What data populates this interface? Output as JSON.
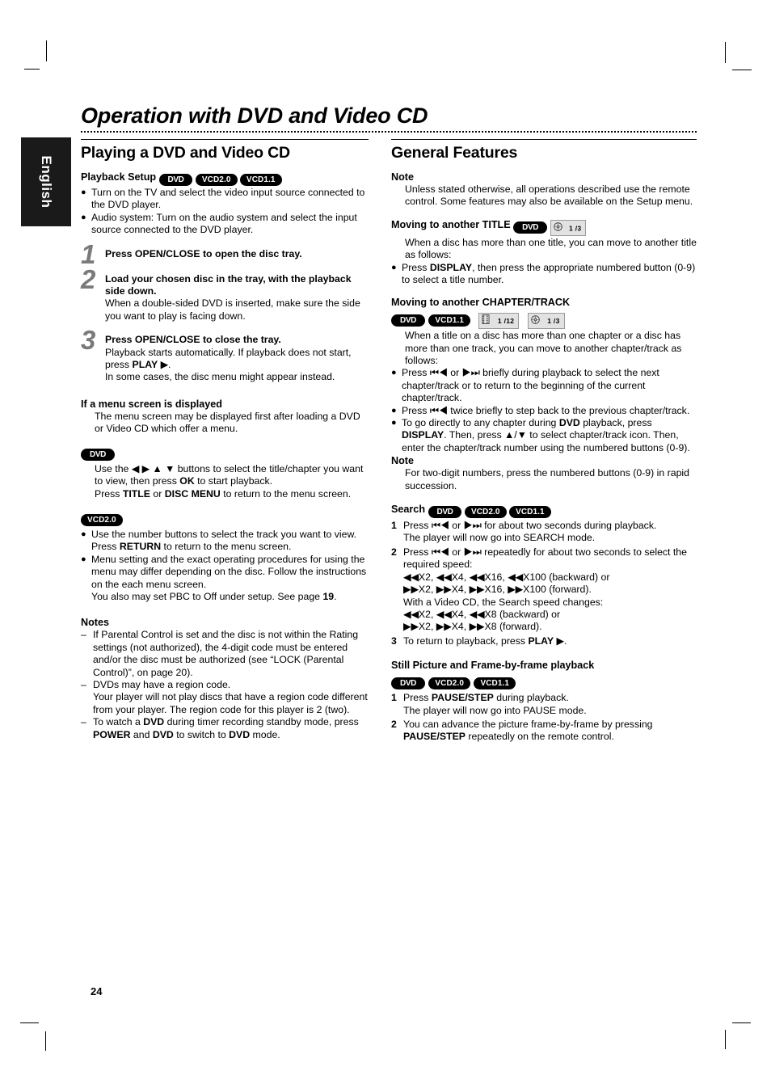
{
  "document": {
    "title": "Operation with DVD and Video CD",
    "language_tab": "English",
    "page_number": "24"
  },
  "pills": {
    "dvd": "DVD",
    "vcd20": "VCD2.0",
    "vcd11": "VCD1.1"
  },
  "badges": {
    "disc_title": "1 /3",
    "chapter": "1 /12",
    "track": "1 /3"
  },
  "left_column": {
    "section_title": "Playing a DVD and Video CD",
    "playback_setup": {
      "heading": "Playback Setup",
      "bullets": [
        "Turn on the TV and select the video input source connected to the DVD player.",
        "Audio system: Turn on the audio system and select the input source connected to the DVD player."
      ]
    },
    "steps": [
      {
        "number": "1",
        "bold": "Press OPEN/CLOSE to open the disc tray.",
        "lines": []
      },
      {
        "number": "2",
        "bold": "Load your chosen disc in the tray, with the playback side down.",
        "lines": [
          "When a double-sided DVD is inserted, make sure the side you want to play is facing down."
        ]
      },
      {
        "number": "3",
        "bold": "Press OPEN/CLOSE to close the tray.",
        "lines": [
          "Playback starts automatically. If playback does not start, press PLAY ▶.",
          "In some cases, the disc menu might appear instead."
        ]
      }
    ],
    "menu_screen": {
      "heading": "If a menu screen is displayed",
      "intro": "The menu screen may be displayed first after loading a DVD or Video CD which offer a menu.",
      "dvd_lines": [
        "Use the ◀ ▶ ▲ ▼ buttons to select the title/chapter you want to view, then press OK to start playback.",
        "Press TITLE or DISC MENU to return to the menu screen."
      ],
      "vcd_bullets": [
        "Use the number buttons to select the track you want to view.",
        "Menu setting and the exact operating procedures for using the menu may differ depending on the disc. Follow the instructions on the each menu screen."
      ],
      "vcd_bullet1_extra": "Press RETURN to return to the menu screen.",
      "vcd_bullet2_extra": "You also may set PBC to Off under setup. See page 19."
    },
    "notes": {
      "heading": "Notes",
      "items": [
        "If Parental Control is set and the disc is not within the Rating settings (not authorized), the 4-digit code must be entered and/or the disc must be authorized (see “LOCK (Parental Control)”, on page 20).",
        "DVDs may have a region code.",
        "To watch a DVD during timer recording standby mode, press POWER and DVD to switch to DVD mode."
      ],
      "region_extra": "Your player will not play discs that have a region code different from your player. The region code for this player is 2 (two)."
    }
  },
  "right_column": {
    "section_title": "General Features",
    "note": {
      "heading": "Note",
      "text": "Unless stated otherwise, all operations described use the remote control. Some features may also be available on the Setup menu."
    },
    "title_section": {
      "heading": "Moving to another TITLE",
      "intro": "When a disc has more than one title, you can move to another title as follows:",
      "bullet": "Press DISPLAY, then press the appropriate numbered button (0-9) to select a title number."
    },
    "chapter_section": {
      "heading": "Moving to another CHAPTER/TRACK",
      "intro": "When a title on a disc has more than one chapter or a disc has more than one track, you can move to another chapter/track as follows:",
      "bullets": [
        "Press ⏮◀ or ▶⏭ briefly during playback to select the next chapter/track or to return to the beginning of the current chapter/track.",
        "Press ⏮◀ twice briefly to step back to the previous chapter/track.",
        "To go directly to any chapter during DVD playback, press DISPLAY. Then, press ▲/▼ to select chapter/track icon. Then, enter the chapter/track number using the numbered buttons (0-9)."
      ],
      "note_heading": "Note",
      "note_text": "For two-digit numbers, press the numbered buttons (0-9) in rapid succession."
    },
    "search_section": {
      "heading": "Search",
      "steps": [
        {
          "number": "1",
          "lines": [
            "Press ⏮◀ or ▶⏭ for about two seconds during playback.",
            "The player will now go into SEARCH mode."
          ]
        },
        {
          "number": "2",
          "lines": [
            "Press ⏮◀ or ▶⏭ repeatedly for about two seconds to select the required speed:",
            "◀◀X2, ◀◀X4, ◀◀X16, ◀◀X100 (backward) or",
            "▶▶X2, ▶▶X4, ▶▶X16, ▶▶X100 (forward).",
            "With a Video CD, the Search speed changes:",
            "◀◀X2, ◀◀X4, ◀◀X8 (backward) or",
            "▶▶X2, ▶▶X4, ▶▶X8 (forward)."
          ]
        },
        {
          "number": "3",
          "lines": [
            "To return to playback, press PLAY ▶."
          ]
        }
      ]
    },
    "still_section": {
      "heading": "Still Picture and Frame-by-frame playback",
      "steps": [
        {
          "number": "1",
          "lines": [
            "Press PAUSE/STEP during playback.",
            "The player will now go into PAUSE mode."
          ]
        },
        {
          "number": "2",
          "lines": [
            "You can advance the picture frame-by-frame by pressing PAUSE/STEP repeatedly on the remote control."
          ]
        }
      ]
    }
  }
}
